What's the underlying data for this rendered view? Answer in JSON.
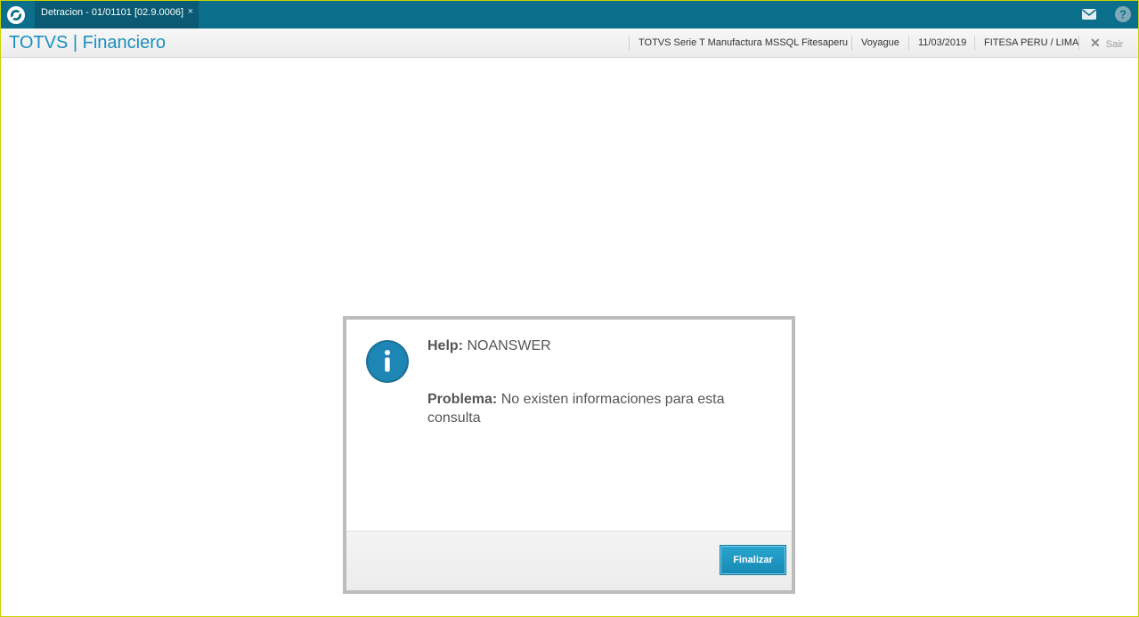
{
  "topbar": {
    "logo_icon": "totvs-logo-icon",
    "tab_label": "Detracion - 01/01101 [02.9.0006]",
    "tab_close": "×",
    "mail_icon": "mail-icon",
    "help_icon": "help-icon"
  },
  "header": {
    "title": "TOTVS | Financiero",
    "environment": "TOTVS Serie T Manufactura MSSQL Fitesaperu",
    "user": "Voyague",
    "date": "11/03/2019",
    "company": "FITESA PERU / LIMA",
    "logout_label": "Sair",
    "logout_icon": "close-icon"
  },
  "dialog": {
    "icon": "info-icon",
    "help_label": "Help:",
    "help_value": "NOANSWER",
    "problem_label": "Problema:",
    "problem_value": "No existen informaciones para esta consulta",
    "button_label": "Finalizar"
  },
  "colors": {
    "topbar": "#0b6e8a",
    "accent": "#1a8fbd",
    "button": "#1c95c0"
  }
}
